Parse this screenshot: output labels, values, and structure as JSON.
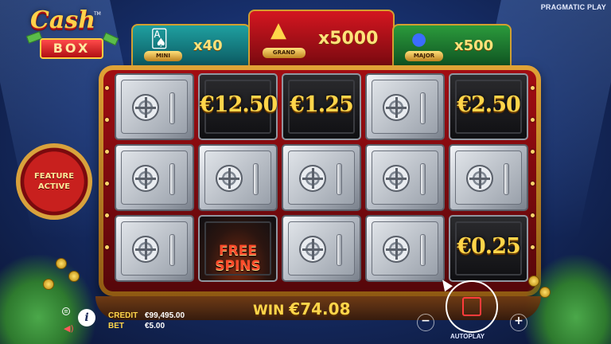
{
  "provider": "PRAGMATIC PLAY",
  "logo": {
    "line1": "Cash",
    "line2": "BOX",
    "tm": "TM"
  },
  "jackpots": [
    {
      "id": "mini",
      "label": "MINI",
      "value": "x40",
      "color": "#1a8f92"
    },
    {
      "id": "grand",
      "label": "GRAND",
      "value": "x5000",
      "color": "#c0121c"
    },
    {
      "id": "major",
      "label": "MAJOR",
      "value": "x500",
      "color": "#22883a"
    }
  ],
  "feature_badge": {
    "line1": "FEATURE",
    "line2": "ACTIVE"
  },
  "grid": {
    "rows": [
      [
        {
          "type": "safe"
        },
        {
          "type": "prize",
          "text": "€12.50"
        },
        {
          "type": "prize",
          "text": "€1.25"
        },
        {
          "type": "safe"
        },
        {
          "type": "prize",
          "text": "€2.50"
        }
      ],
      [
        {
          "type": "safe"
        },
        {
          "type": "safe"
        },
        {
          "type": "safe"
        },
        {
          "type": "safe"
        },
        {
          "type": "safe"
        }
      ],
      [
        {
          "type": "safe"
        },
        {
          "type": "free",
          "line1": "FREE",
          "line2": "SPINS"
        },
        {
          "type": "safe"
        },
        {
          "type": "safe"
        },
        {
          "type": "prize",
          "text": "€0.25"
        }
      ]
    ]
  },
  "win": {
    "label": "WIN",
    "amount": "€74.08"
  },
  "meters": {
    "credit_label": "CREDIT",
    "credit_value": "€99,495.00",
    "bet_label": "BET",
    "bet_value": "€5.00"
  },
  "controls": {
    "autoplay_label": "AUTOPLAY",
    "minus": "−",
    "plus": "+"
  },
  "colors": {
    "accent_gold": "#ffd54a",
    "frame": "#c98a22",
    "stop": "#ff3b3b"
  }
}
